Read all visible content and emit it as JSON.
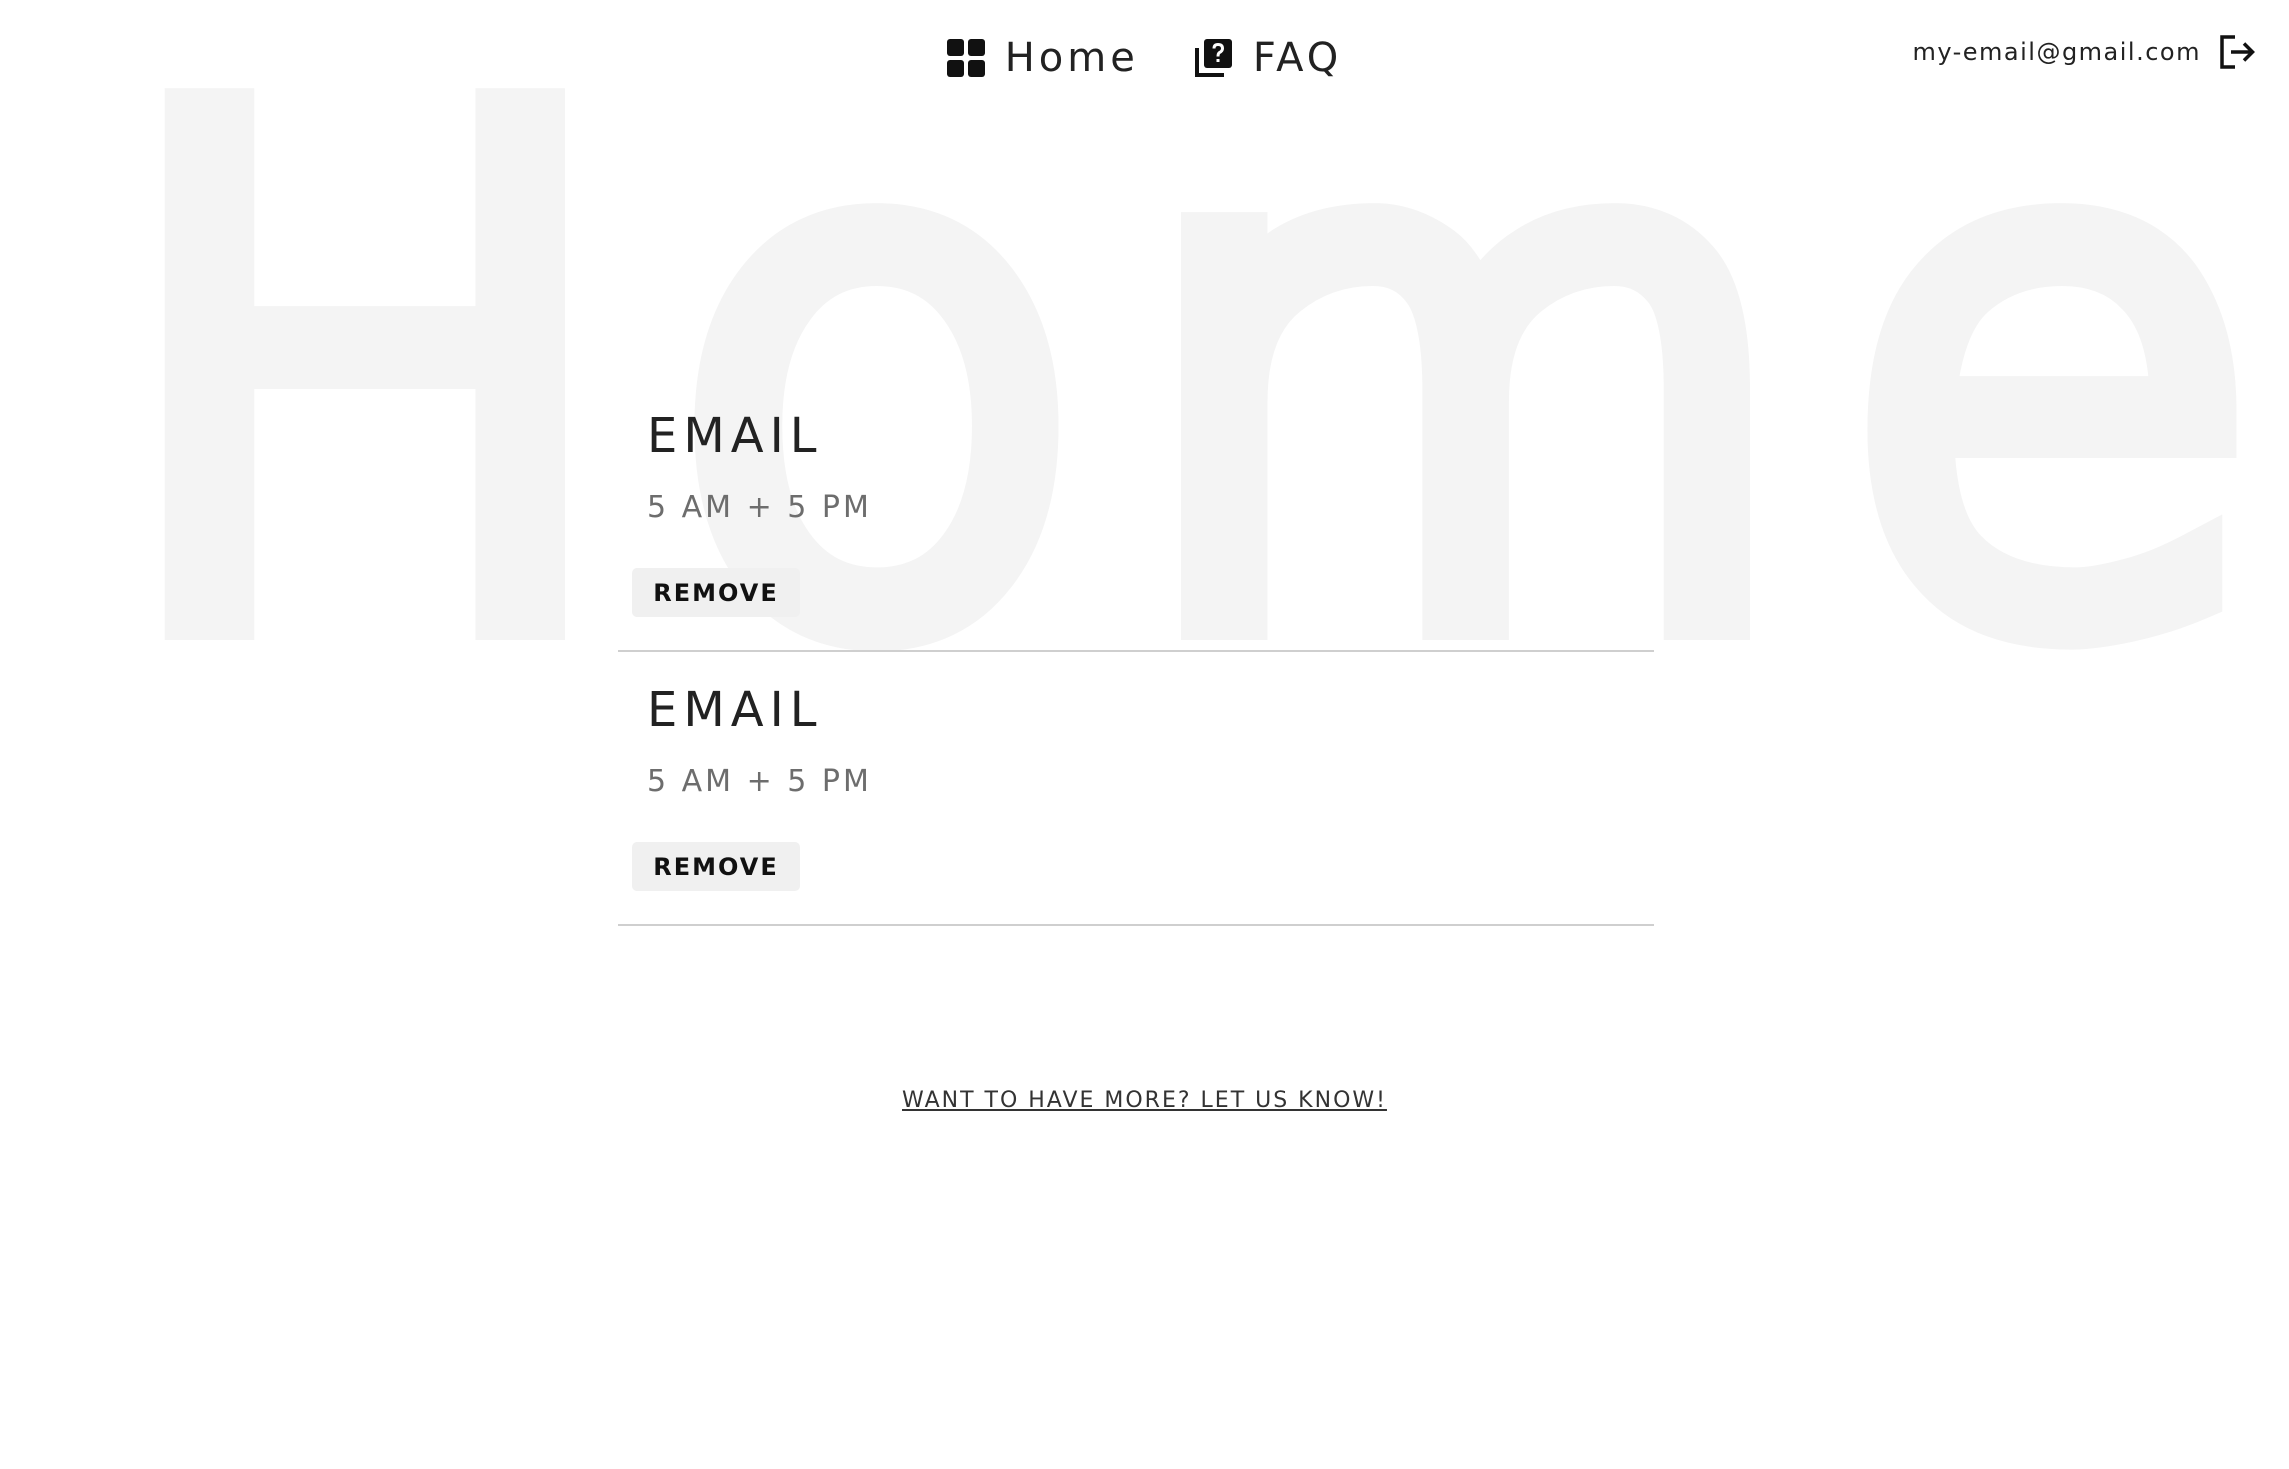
{
  "background": {
    "watermark_text": "Home",
    "watermark_color": "#f4f4f4"
  },
  "nav": {
    "items": [
      {
        "label": "Home",
        "icon": "dashboard-icon"
      },
      {
        "label": "FAQ",
        "icon": "faq-icon"
      }
    ]
  },
  "account": {
    "email": "my-email@gmail.com",
    "logout_icon": "logout-icon"
  },
  "subscriptions": [
    {
      "title": "EMAIL",
      "schedule": "5 AM + 5 PM",
      "remove_label": "REMOVE"
    },
    {
      "title": "EMAIL",
      "schedule": "5 AM + 5 PM",
      "remove_label": "REMOVE"
    }
  ],
  "footer": {
    "more_link": "WANT TO HAVE MORE? LET US KNOW!"
  },
  "colors": {
    "text": "#222222",
    "muted_text": "#6d6d6d",
    "button_bg": "#f0f0f0",
    "divider": "#cfcfcf"
  }
}
